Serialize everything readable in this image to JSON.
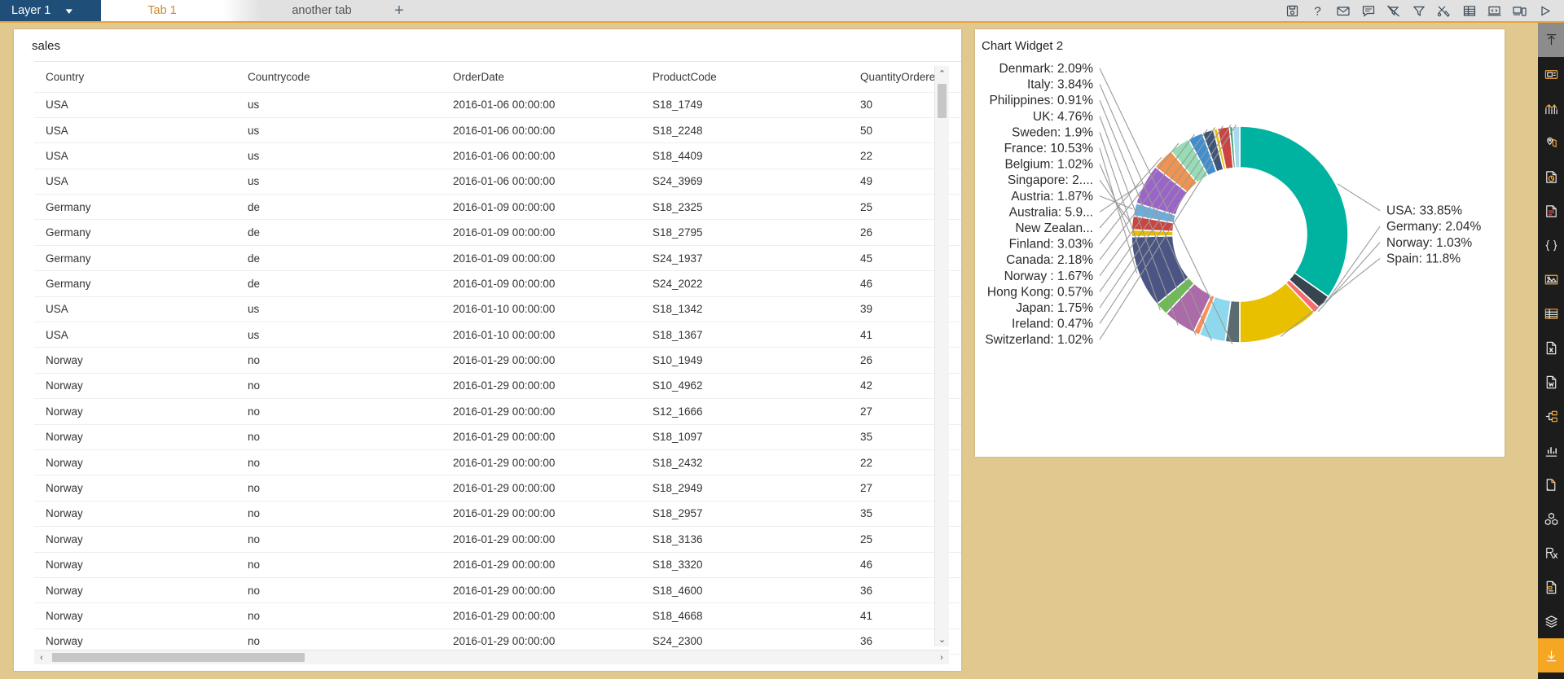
{
  "window": {
    "accent_orange": "#e8a33d",
    "layer_tab_bg": "#1f4e79",
    "canvas_bg": "#e0c88e",
    "sidebar_bg": "#1c1c1c"
  },
  "tabbar": {
    "layer": {
      "label": "Layer 1",
      "caret_icon": "chevron-down-icon"
    },
    "tabs": [
      {
        "label": "Tab 1",
        "active": true
      },
      {
        "label": "another tab",
        "active": false
      }
    ],
    "add_tab_label": "+",
    "tool_icons": [
      "save-disk-icon",
      "help-question-icon",
      "mail-envelope-icon",
      "comment-bubble-icon",
      "clear-filter-icon",
      "filter-funnel-icon",
      "tools-wrench-icon",
      "table-grid-icon",
      "code-laptop-icon",
      "responsive-devices-icon",
      "run-play-icon"
    ]
  },
  "table_widget": {
    "title": "sales",
    "columns": [
      "Country",
      "Countrycode",
      "OrderDate",
      "ProductCode",
      "QuantityOrdered"
    ],
    "rows": [
      [
        "USA",
        "us",
        "2016-01-06 00:00:00",
        "S18_1749",
        "30"
      ],
      [
        "USA",
        "us",
        "2016-01-06 00:00:00",
        "S18_2248",
        "50"
      ],
      [
        "USA",
        "us",
        "2016-01-06 00:00:00",
        "S18_4409",
        "22"
      ],
      [
        "USA",
        "us",
        "2016-01-06 00:00:00",
        "S24_3969",
        "49"
      ],
      [
        "Germany",
        "de",
        "2016-01-09 00:00:00",
        "S18_2325",
        "25"
      ],
      [
        "Germany",
        "de",
        "2016-01-09 00:00:00",
        "S18_2795",
        "26"
      ],
      [
        "Germany",
        "de",
        "2016-01-09 00:00:00",
        "S24_1937",
        "45"
      ],
      [
        "Germany",
        "de",
        "2016-01-09 00:00:00",
        "S24_2022",
        "46"
      ],
      [
        "USA",
        "us",
        "2016-01-10 00:00:00",
        "S18_1342",
        "39"
      ],
      [
        "USA",
        "us",
        "2016-01-10 00:00:00",
        "S18_1367",
        "41"
      ],
      [
        "Norway",
        "no",
        "2016-01-29 00:00:00",
        "S10_1949",
        "26"
      ],
      [
        "Norway",
        "no",
        "2016-01-29 00:00:00",
        "S10_4962",
        "42"
      ],
      [
        "Norway",
        "no",
        "2016-01-29 00:00:00",
        "S12_1666",
        "27"
      ],
      [
        "Norway",
        "no",
        "2016-01-29 00:00:00",
        "S18_1097",
        "35"
      ],
      [
        "Norway",
        "no",
        "2016-01-29 00:00:00",
        "S18_2432",
        "22"
      ],
      [
        "Norway",
        "no",
        "2016-01-29 00:00:00",
        "S18_2949",
        "27"
      ],
      [
        "Norway",
        "no",
        "2016-01-29 00:00:00",
        "S18_2957",
        "35"
      ],
      [
        "Norway",
        "no",
        "2016-01-29 00:00:00",
        "S18_3136",
        "25"
      ],
      [
        "Norway",
        "no",
        "2016-01-29 00:00:00",
        "S18_3320",
        "46"
      ],
      [
        "Norway",
        "no",
        "2016-01-29 00:00:00",
        "S18_4600",
        "36"
      ],
      [
        "Norway",
        "no",
        "2016-01-29 00:00:00",
        "S18_4668",
        "41"
      ],
      [
        "Norway",
        "no",
        "2016-01-29 00:00:00",
        "S24_2300",
        "36"
      ]
    ],
    "scrollbars": {
      "up_arrow": "⌃",
      "down_arrow": "⌄",
      "left_arrow": "‹",
      "right_arrow": "›"
    }
  },
  "chart_widget": {
    "title": "Chart Widget 2"
  },
  "chart_data": {
    "type": "pie",
    "variant": "donut",
    "title": "Chart Widget 2",
    "xlabel": "",
    "ylabel": "",
    "legend_position": "labels-outside-with-leaders",
    "grid": false,
    "value_unit": "percent",
    "slices": [
      {
        "label": "USA",
        "value": 33.85,
        "label_text": "USA: 33.85%",
        "color": "#00b3a0"
      },
      {
        "label": "Germany",
        "value": 2.04,
        "label_text": "Germany: 2.04%",
        "color": "#36454f"
      },
      {
        "label": "Norway",
        "value": 1.03,
        "label_text": "Norway: 1.03%",
        "color": "#f96c6c"
      },
      {
        "label": "Spain",
        "value": 11.8,
        "label_text": "Spain: 11.8%",
        "color": "#e8c000"
      },
      {
        "label": "Denmark",
        "value": 2.09,
        "label_text": "Denmark: 2.09%",
        "color": "#5a6b72"
      },
      {
        "label": "Italy",
        "value": 3.84,
        "label_text": "Italy: 3.84%",
        "color": "#8ed8ee"
      },
      {
        "label": "Philippines",
        "value": 0.91,
        "label_text": "Philippines: 0.91%",
        "color": "#f98e5a"
      },
      {
        "label": "UK",
        "value": 4.76,
        "label_text": "UK: 4.76%",
        "color": "#ab6aa8"
      },
      {
        "label": "Sweden",
        "value": 1.9,
        "label_text": "Sweden: 1.9%",
        "color": "#6fba57"
      },
      {
        "label": "France",
        "value": 10.53,
        "label_text": "France: 10.53%",
        "color": "#4a5584"
      },
      {
        "label": "Belgium",
        "value": 1.02,
        "label_text": "Belgium: 1.02%",
        "color": "#e8c000"
      },
      {
        "label": "Singapore",
        "value": 2.0,
        "label_text": "Singapore: 2....",
        "color": "#cc4440"
      },
      {
        "label": "Austria",
        "value": 1.87,
        "label_text": "Austria: 1.87%",
        "color": "#6aaede"
      },
      {
        "label": "Australia",
        "value": 5.9,
        "label_text": "Australia: 5.9...",
        "color": "#9b64c8"
      },
      {
        "label": "New Zealand",
        "value": 3.2,
        "label_text": "New Zealan...",
        "color": "#ef9350"
      },
      {
        "label": "Finland",
        "value": 3.03,
        "label_text": "Finland: 3.03%",
        "color": "#97dcb4"
      },
      {
        "label": "Canada",
        "value": 2.18,
        "label_text": "Canada: 2.18%",
        "color": "#3f8fd0"
      },
      {
        "label": "Norway ",
        "value": 1.67,
        "label_text": "Norway : 1.67%",
        "color": "#3f5578"
      },
      {
        "label": "Hong Kong",
        "value": 0.57,
        "label_text": "Hong Kong: 0.57%",
        "color": "#e8c000"
      },
      {
        "label": "Japan",
        "value": 1.75,
        "label_text": "Japan: 1.75%",
        "color": "#cc4440"
      },
      {
        "label": "Ireland",
        "value": 0.47,
        "label_text": "Ireland: 0.47%",
        "color": "#2e9e6b"
      },
      {
        "label": "Switzerland",
        "value": 1.02,
        "label_text": "Switzerland: 1.02%",
        "color": "#a9d8ef"
      }
    ]
  },
  "sidebar": {
    "items": [
      {
        "icon": "collapse-up-icon",
        "state": "selected"
      },
      {
        "icon": "card-widget-icon",
        "state": "normal"
      },
      {
        "icon": "bar-chart-icon",
        "state": "normal"
      },
      {
        "icon": "map-pin-icon",
        "state": "normal"
      },
      {
        "icon": "pie-doc-icon",
        "state": "normal"
      },
      {
        "icon": "text-doc-icon",
        "state": "normal"
      },
      {
        "icon": "braces-code-icon",
        "state": "normal"
      },
      {
        "icon": "image-widget-icon",
        "state": "normal"
      },
      {
        "icon": "table-widget-icon",
        "state": "normal"
      },
      {
        "icon": "excel-file-icon",
        "state": "normal"
      },
      {
        "icon": "word-file-icon",
        "state": "normal"
      },
      {
        "icon": "tree-hierarchy-icon",
        "state": "normal"
      },
      {
        "icon": "sparkline-icon",
        "state": "normal"
      },
      {
        "icon": "file-copy-icon",
        "state": "normal"
      },
      {
        "icon": "cube-blocks-icon",
        "state": "normal"
      },
      {
        "icon": "r-script-icon",
        "state": "normal"
      },
      {
        "icon": "page-settings-icon",
        "state": "normal"
      },
      {
        "icon": "layers-icon",
        "state": "normal"
      },
      {
        "icon": "download-icon",
        "state": "highlighted"
      }
    ]
  }
}
